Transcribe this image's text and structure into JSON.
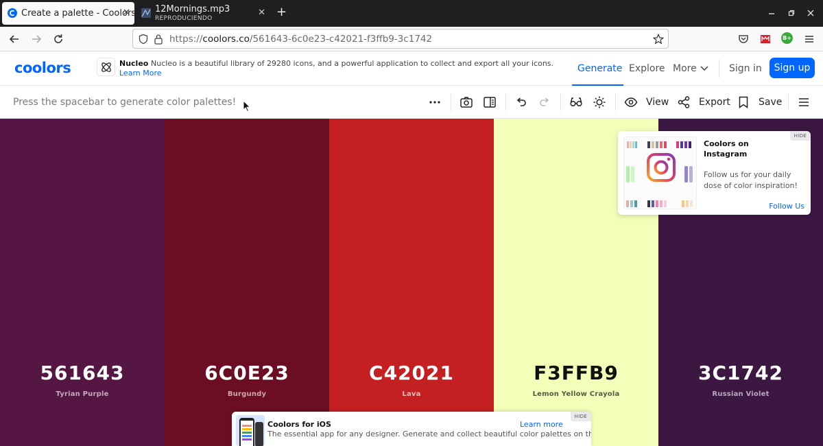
{
  "browser": {
    "tabs": [
      {
        "title": "Create a palette - Coolors",
        "close": "✕"
      },
      {
        "title": "12Mornings.mp3",
        "subtitle": "REPRODUCIENDO",
        "close": "✕"
      }
    ],
    "new_tab": "+",
    "url_prefix": "https://",
    "url_host": "coolors.co",
    "url_path": "/561643-6c0e23-c42021-f3ffb9-3c1742",
    "extension_badge": "B+"
  },
  "header": {
    "logo": "coolors",
    "promo": {
      "brand": "Nucleo",
      "text": "Nucleo is a beautiful library of 29280 icons, and a powerful application to collect and export all your icons.",
      "link": "Learn More"
    },
    "nav": {
      "generate": "Generate",
      "explore": "Explore",
      "more": "More",
      "signin": "Sign in",
      "signup": "Sign up"
    }
  },
  "toolbar": {
    "hint": "Press the spacebar to generate color palettes!",
    "view": "View",
    "export": "Export",
    "save": "Save"
  },
  "palette": [
    {
      "hex": "561643",
      "name": "Tyrian Purple",
      "color": "#561643",
      "text_color": "#ffffff",
      "label_color": "#c8aabd"
    },
    {
      "hex": "6C0E23",
      "name": "Burgundy",
      "color": "#6c0e23",
      "text_color": "#ffffff",
      "label_color": "#cfa7b0"
    },
    {
      "hex": "C42021",
      "name": "Lava",
      "color": "#c42021",
      "text_color": "#ffffff",
      "label_color": "#efb7b7"
    },
    {
      "hex": "F3FFB9",
      "name": "Lemon Yellow Crayola",
      "color": "#f3ffb9",
      "text_color": "#111111",
      "label_color": "#555a44"
    },
    {
      "hex": "3C1742",
      "name": "Russian Violet",
      "color": "#3c1742",
      "text_color": "#ffffff",
      "label_color": "#b9a9bd"
    }
  ],
  "instagram_card": {
    "title": "Coolors on Instagram",
    "body": "Follow us for your daily dose of color inspiration!",
    "link": "Follow Us",
    "hide": "HIDE"
  },
  "ios_card": {
    "title": "Coolors for iOS",
    "link": "Learn more",
    "body": "The essential app for any designer. Generate and collect beautiful color palettes on the go.",
    "hide": "HIDE"
  },
  "colors": {
    "accent": "#0066ff",
    "tabstrip": "#1f1f22"
  }
}
